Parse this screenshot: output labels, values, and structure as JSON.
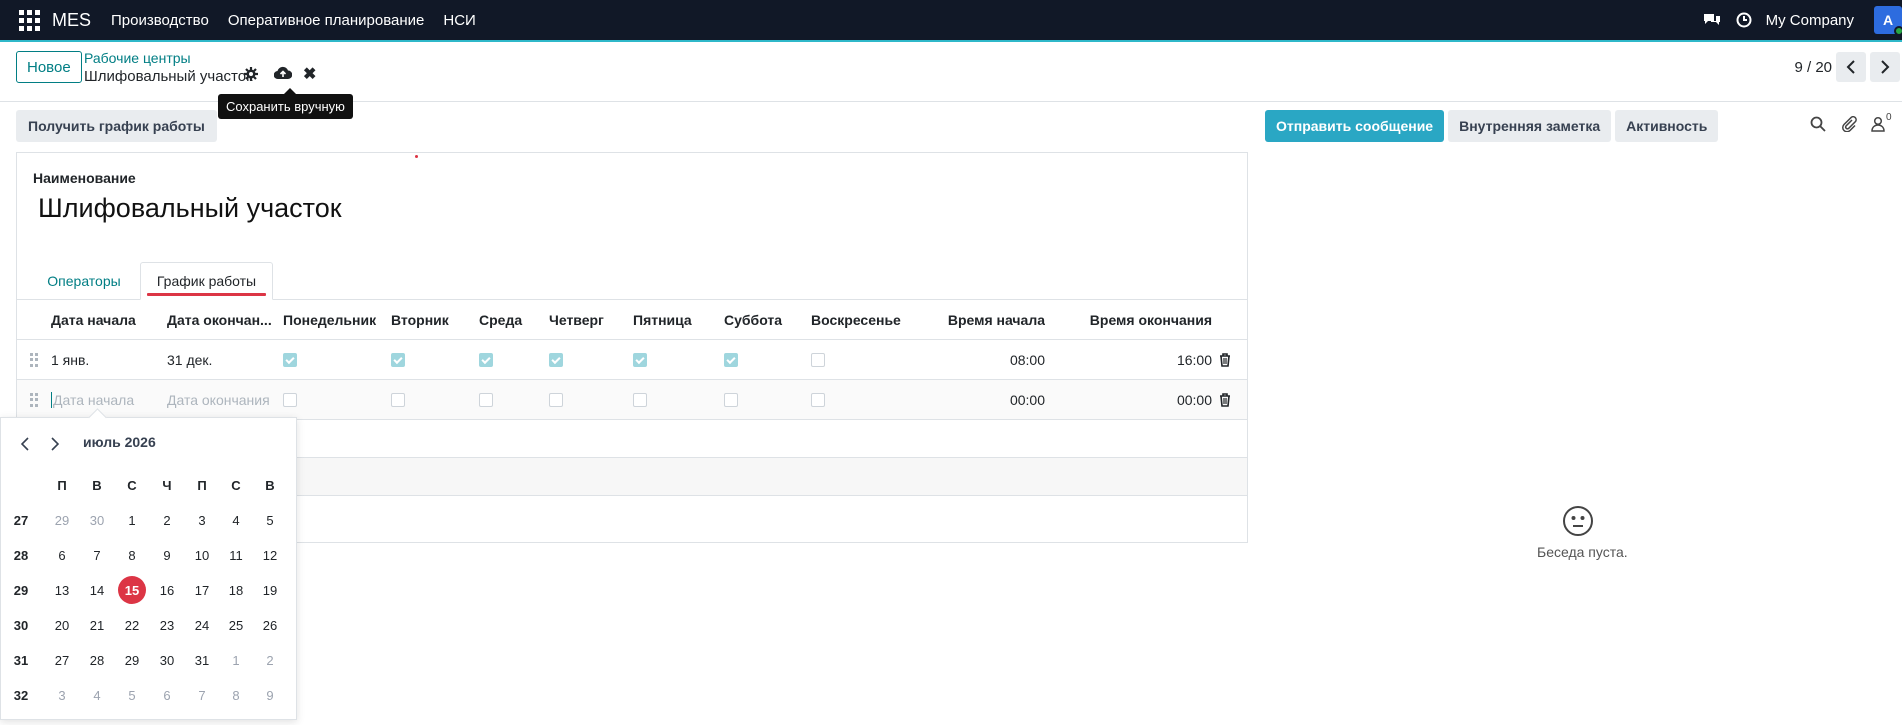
{
  "navbar": {
    "brand": "MES",
    "menu": [
      "Производство",
      "Оперативное планирование",
      "НСИ"
    ],
    "company": "My Company",
    "avatar_letter": "A"
  },
  "control_panel": {
    "new_button": "Новое",
    "breadcrumb_parent": "Рабочие центры",
    "breadcrumb_current": "Шлифовальный участок",
    "tooltip": "Сохранить вручную",
    "pager": "9 / 20"
  },
  "actions": {
    "get_schedule": "Получить график работы",
    "send_message": "Отправить сообщение",
    "internal_note": "Внутренняя заметка",
    "activity": "Активность",
    "followers_count": "0"
  },
  "form": {
    "name_label": "Наименование",
    "name_value": "Шлифовальный участок",
    "tabs": [
      "Операторы",
      "График работы"
    ],
    "active_tab": "График работы",
    "columns": [
      "Дата начала",
      "Дата окончан...",
      "Понедельник",
      "Вторник",
      "Среда",
      "Четверг",
      "Пятница",
      "Суббота",
      "Воскресенье",
      "Время начала",
      "Время окончания"
    ],
    "rows": [
      {
        "start_date": "1 янв.",
        "end_date": "31 дек.",
        "days": [
          true,
          true,
          true,
          true,
          true,
          true,
          false
        ],
        "start_time": "08:00",
        "end_time": "16:00"
      },
      {
        "start_placeholder": "Дата начала",
        "end_placeholder": "Дата окончания",
        "days": [
          false,
          false,
          false,
          false,
          false,
          false,
          false
        ],
        "start_time": "00:00",
        "end_time": "00:00"
      }
    ]
  },
  "datepicker": {
    "title": "июль 2026",
    "weekdays": [
      "П",
      "В",
      "С",
      "Ч",
      "П",
      "С",
      "В"
    ],
    "weeks": [
      {
        "num": "27",
        "days": [
          [
            "29",
            true
          ],
          [
            "30",
            true
          ],
          [
            "1",
            false
          ],
          [
            "2",
            false
          ],
          [
            "3",
            false
          ],
          [
            "4",
            false
          ],
          [
            "5",
            false
          ]
        ]
      },
      {
        "num": "28",
        "days": [
          [
            "6",
            false
          ],
          [
            "7",
            false
          ],
          [
            "8",
            false
          ],
          [
            "9",
            false
          ],
          [
            "10",
            false
          ],
          [
            "11",
            false
          ],
          [
            "12",
            false
          ]
        ]
      },
      {
        "num": "29",
        "days": [
          [
            "13",
            false
          ],
          [
            "14",
            false
          ],
          [
            "15",
            false
          ],
          [
            "16",
            false
          ],
          [
            "17",
            false
          ],
          [
            "18",
            false
          ],
          [
            "19",
            false
          ]
        ]
      },
      {
        "num": "30",
        "days": [
          [
            "20",
            false
          ],
          [
            "21",
            false
          ],
          [
            "22",
            false
          ],
          [
            "23",
            false
          ],
          [
            "24",
            false
          ],
          [
            "25",
            false
          ],
          [
            "26",
            false
          ]
        ]
      },
      {
        "num": "31",
        "days": [
          [
            "27",
            false
          ],
          [
            "28",
            false
          ],
          [
            "29",
            false
          ],
          [
            "30",
            false
          ],
          [
            "31",
            false
          ],
          [
            "1",
            true
          ],
          [
            "2",
            true
          ]
        ]
      },
      {
        "num": "32",
        "days": [
          [
            "3",
            true
          ],
          [
            "4",
            true
          ],
          [
            "5",
            true
          ],
          [
            "6",
            true
          ],
          [
            "7",
            true
          ],
          [
            "8",
            true
          ],
          [
            "9",
            true
          ]
        ]
      }
    ],
    "today": "15"
  },
  "chatter": {
    "empty_text": "Беседа пуста."
  },
  "colors": {
    "accent": "#017e84",
    "primary_button": "#2aa7c4",
    "navbar": "#111827",
    "today": "#dc3545"
  }
}
